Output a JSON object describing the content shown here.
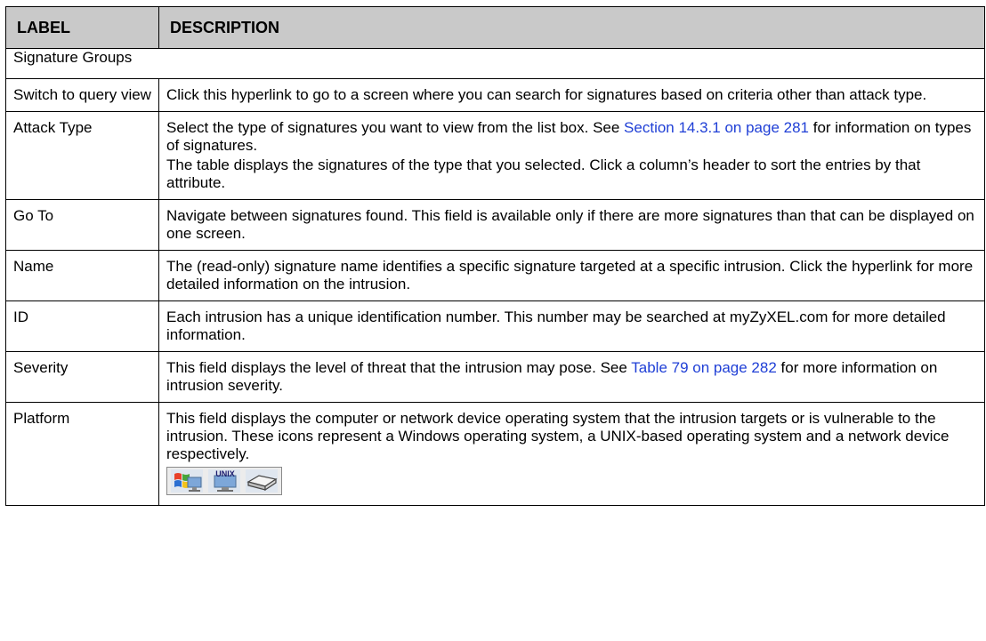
{
  "table": {
    "header": {
      "label": "LABEL",
      "description": "DESCRIPTION"
    },
    "section_title": "Signature Groups",
    "rows": [
      {
        "label": "Switch to query view",
        "text": "Click this hyperlink to go to a screen where you can search for signatures based on criteria other than attack type."
      },
      {
        "label": "Attack Type",
        "text_before_link": "Select the type of signatures you want to view from the list box. See ",
        "link": "Section 14.3.1 on page 281",
        "text_after_link": " for information on types of signatures.",
        "text2": "The table displays the signatures of the type that you selected. Click a column’s header to sort the entries by that attribute."
      },
      {
        "label": "Go To",
        "text": "Navigate between signatures found. This field is available only if there are more signatures than that can be displayed on one screen."
      },
      {
        "label": "Name",
        "text": "The (read-only) signature name identifies a specific signature targeted at a specific intrusion. Click the hyperlink for more detailed information on the intrusion."
      },
      {
        "label": "ID",
        "text": "Each intrusion has a unique identification number. This number may be searched at myZyXEL.com for more detailed information."
      },
      {
        "label": "Severity",
        "text_before_link": "This field displays the level of threat that the intrusion may pose. See ",
        "link": "Table 79 on page 282",
        "text_after_link": " for more information on intrusion severity."
      },
      {
        "label": "Platform",
        "text": "This field displays the computer or network device operating system that the intrusion targets or is vulnerable to the intrusion. These icons represent a Windows operating system, a UNIX-based operating system and a network device respectively.",
        "icons": [
          "windows-os-icon",
          "unix-os-icon",
          "network-device-icon"
        ],
        "unix_icon_text": "UNIX"
      }
    ]
  },
  "colors": {
    "header_bg": "#c9c9c9",
    "link": "#1f3fd6",
    "border": "#000000"
  }
}
